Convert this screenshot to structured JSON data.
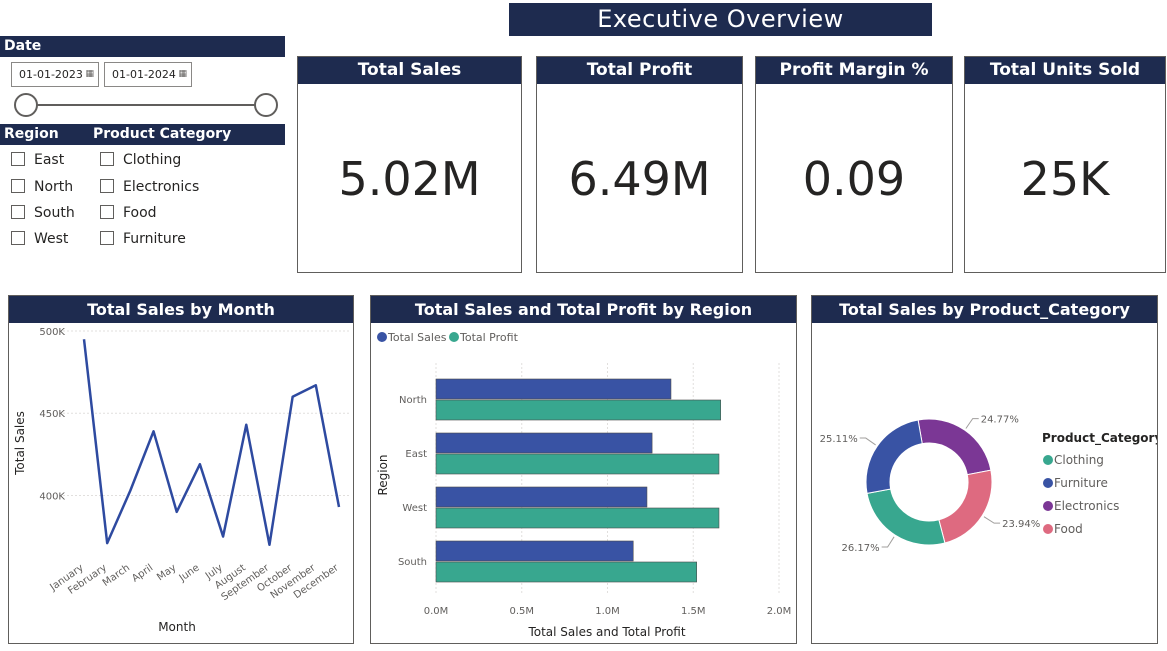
{
  "title": "Executive Overview",
  "date_slicer": {
    "label": "Date",
    "start": "01-01-2023",
    "end": "01-01-2024",
    "calendar_icon": "calendar-icon"
  },
  "region_slicer": {
    "label": "Region",
    "items": [
      "East",
      "North",
      "South",
      "West"
    ]
  },
  "category_slicer": {
    "label": "Product Category",
    "items": [
      "Clothing",
      "Electronics",
      "Food",
      "Furniture"
    ]
  },
  "kpis": [
    {
      "label": "Total Sales",
      "value": "5.02M"
    },
    {
      "label": "Total Profit",
      "value": "6.49M"
    },
    {
      "label": "Profit Margin %",
      "value": "0.09"
    },
    {
      "label": "Total Units Sold",
      "value": "25K"
    }
  ],
  "colors": {
    "navy": "#1e2b4f",
    "line": "#2e4aa0",
    "sales": "#3953a4",
    "profit": "#38a78f",
    "clothing": "#38a78f",
    "furniture": "#3953a4",
    "electronics": "#7b3795",
    "food": "#de6a80"
  },
  "chart_data": [
    {
      "type": "line",
      "title": "Total Sales by Month",
      "xlabel": "Month",
      "ylabel": "Total Sales",
      "categories": [
        "January",
        "February",
        "March",
        "April",
        "May",
        "June",
        "July",
        "August",
        "September",
        "October",
        "November",
        "December"
      ],
      "values": [
        495000,
        371000,
        403000,
        439000,
        390000,
        419000,
        375000,
        443000,
        370000,
        460000,
        467000,
        393000
      ],
      "y_ticks": [
        "400K",
        "450K",
        "500K"
      ],
      "ylim": [
        365000,
        500000
      ],
      "grid": true
    },
    {
      "type": "bar",
      "orientation": "horizontal",
      "title": "Total Sales and Total Profit by Region",
      "xlabel": "Total Sales and Total Profit",
      "ylabel": "Region",
      "categories": [
        "North",
        "East",
        "West",
        "South"
      ],
      "series": [
        {
          "name": "Total Sales",
          "values": [
            1.37,
            1.26,
            1.23,
            1.15
          ]
        },
        {
          "name": "Total Profit",
          "values": [
            1.66,
            1.65,
            1.65,
            1.52
          ]
        }
      ],
      "x_ticks": [
        "0.0M",
        "0.5M",
        "1.0M",
        "1.5M",
        "2.0M"
      ],
      "xlim": [
        0,
        2.0
      ],
      "legend": "top-left",
      "grid": true
    },
    {
      "type": "pie",
      "title": "Total Sales by Product_Category",
      "legend_title": "Product_Category",
      "slices": [
        {
          "name": "Clothing",
          "value": 26.17,
          "label": "26.17%"
        },
        {
          "name": "Furniture",
          "value": 25.11,
          "label": "25.11%"
        },
        {
          "name": "Electronics",
          "value": 24.77,
          "label": "24.77%"
        },
        {
          "name": "Food",
          "value": 23.94,
          "label": "23.94%"
        }
      ],
      "legend": "right"
    }
  ]
}
